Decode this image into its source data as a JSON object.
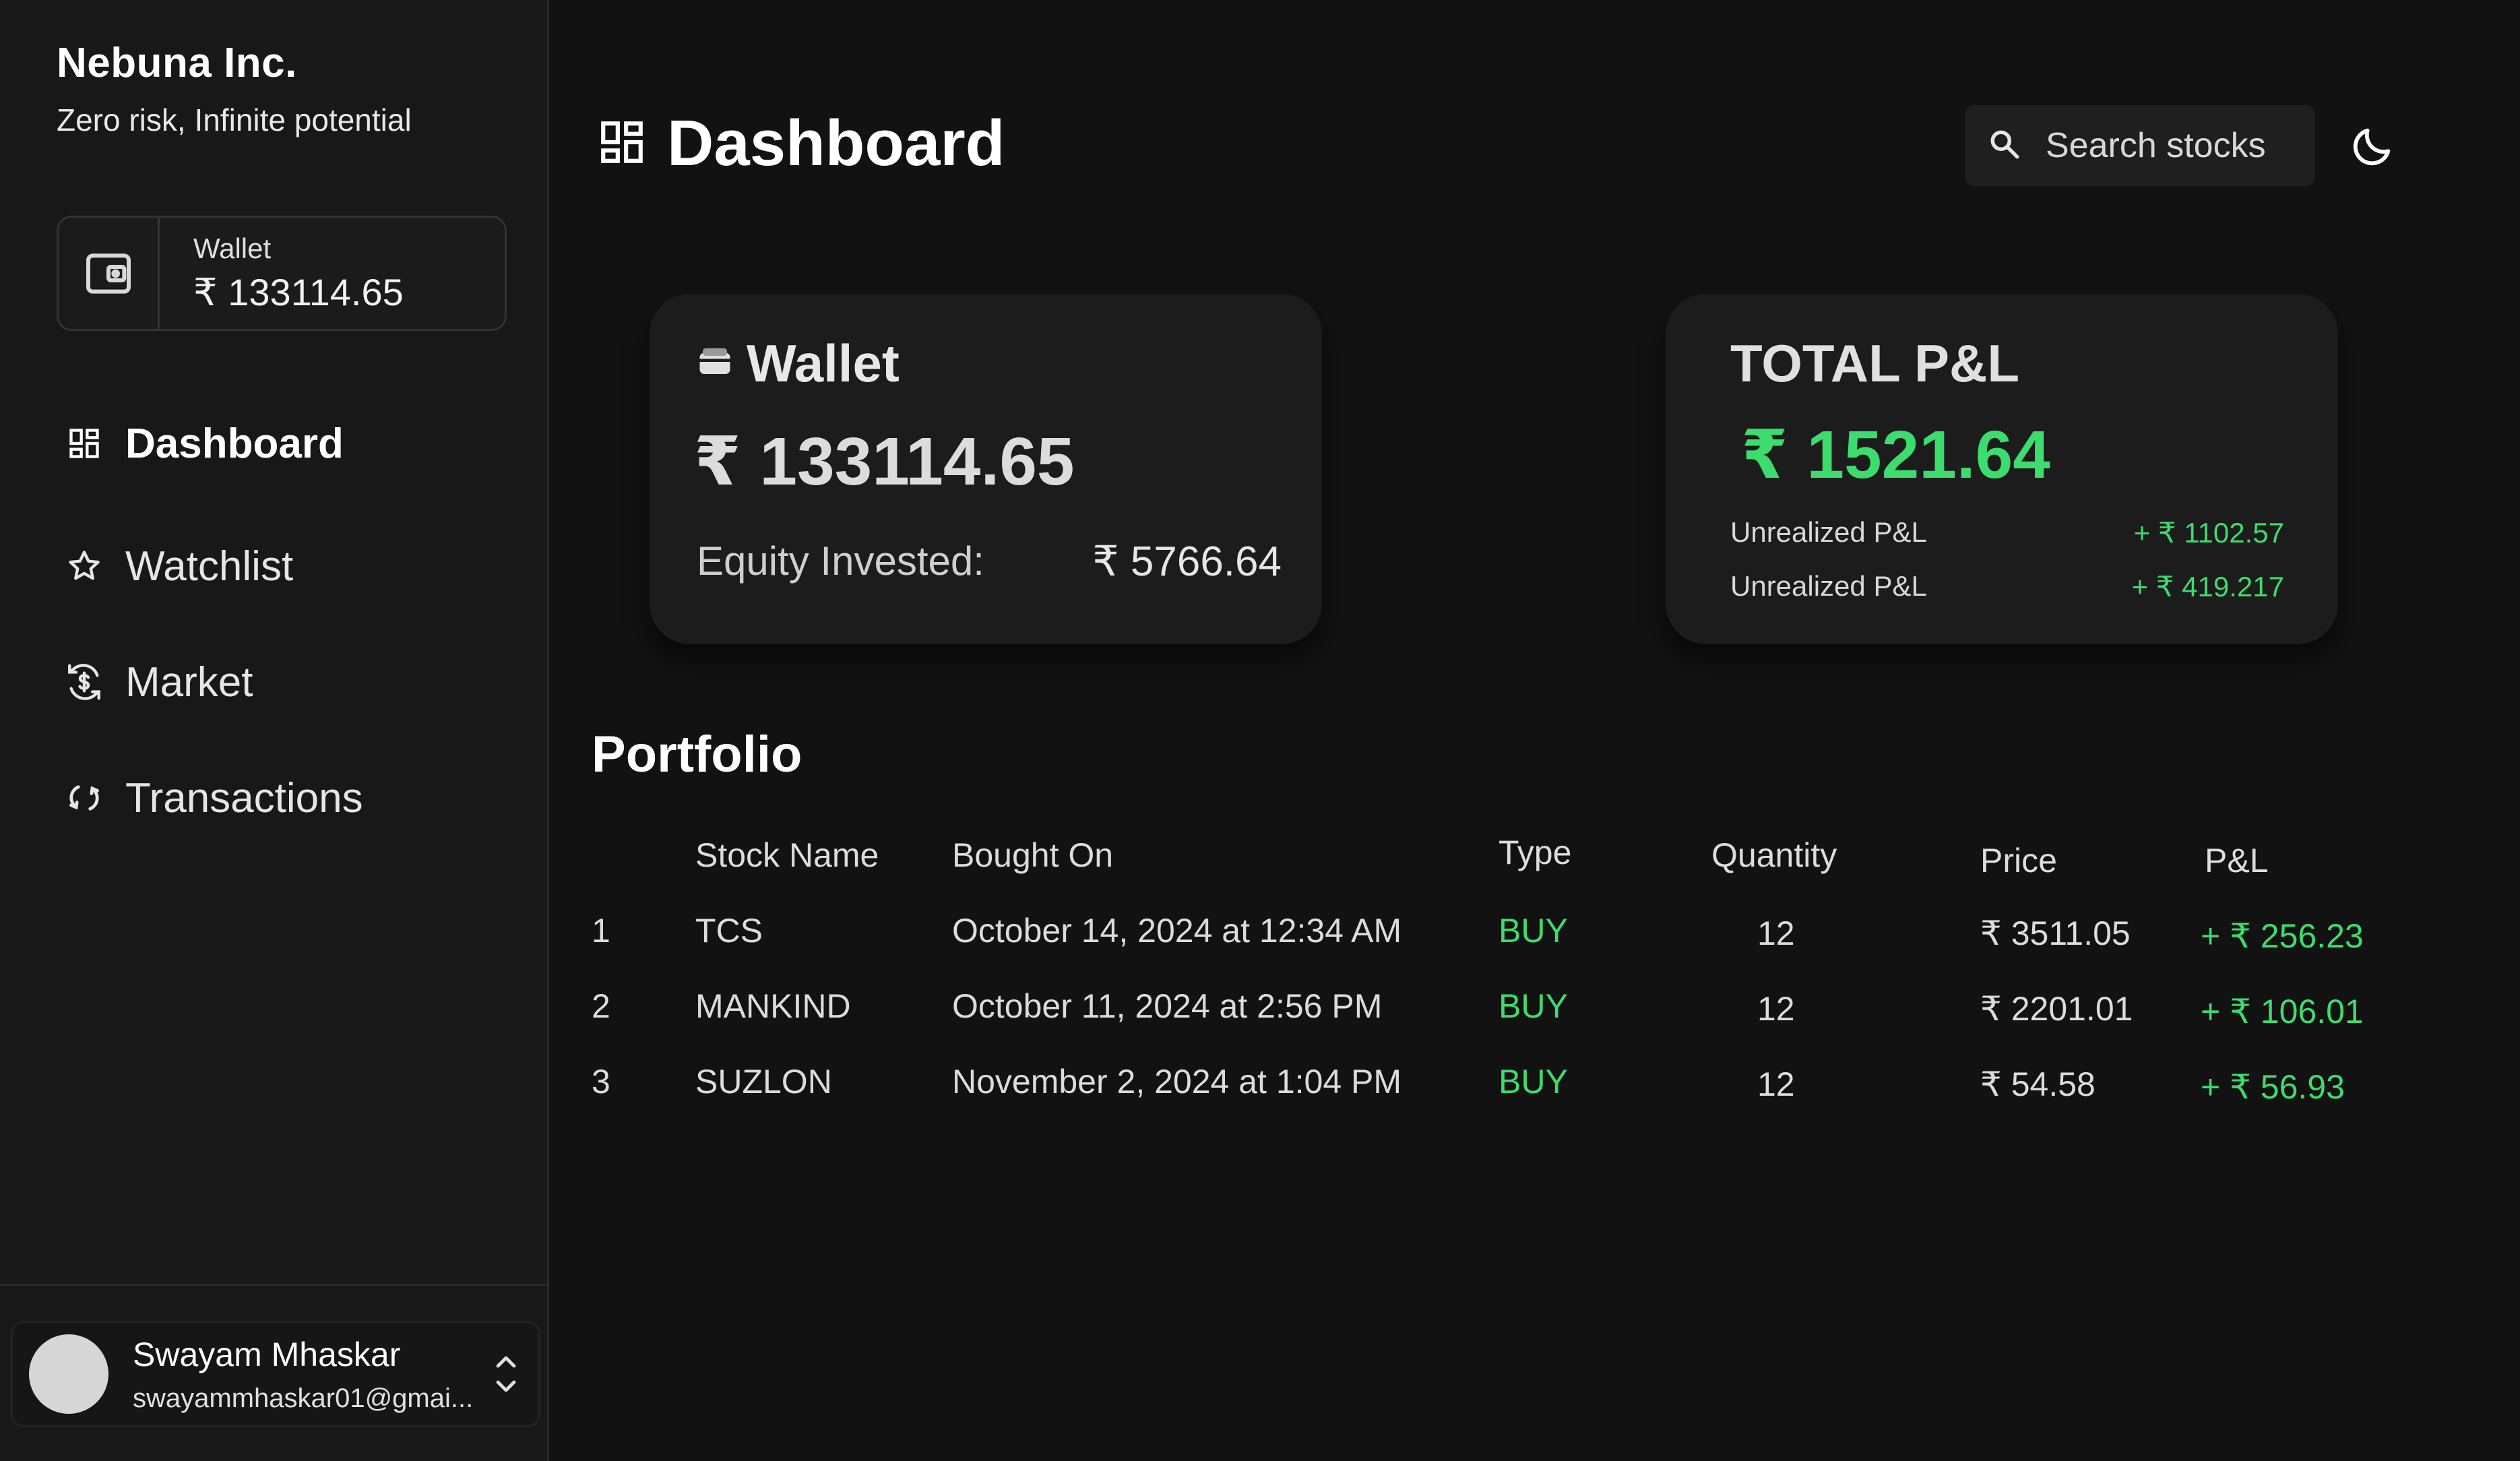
{
  "brand": {
    "name": "Nebuna Inc.",
    "tagline": "Zero risk, Infinite potential"
  },
  "sidebar": {
    "wallet": {
      "label": "Wallet",
      "value": "₹ 133114.65"
    },
    "nav": [
      {
        "label": "Dashboard",
        "icon": "dashboard-icon",
        "active": true
      },
      {
        "label": "Watchlist",
        "icon": "star-icon",
        "active": false
      },
      {
        "label": "Market",
        "icon": "currency-exchange-icon",
        "active": false
      },
      {
        "label": "Transactions",
        "icon": "sync-icon",
        "active": false
      }
    ],
    "user": {
      "name": "Swayam Mhaskar",
      "email": "swayammhaskar01@gmai..."
    }
  },
  "header": {
    "title": "Dashboard",
    "search_placeholder": "Search stocks"
  },
  "wallet_card": {
    "title": "Wallet",
    "balance": "₹ 133114.65",
    "equity_label": "Equity Invested:",
    "equity_value": "₹ 5766.64"
  },
  "pl_card": {
    "title": "TOTAL P&L",
    "total": "₹ 1521.64",
    "rows": [
      {
        "label": "Unrealized P&L",
        "value": "+ ₹ 1102.57"
      },
      {
        "label": "Unrealized P&L",
        "value": "+ ₹ 419.217"
      }
    ]
  },
  "portfolio": {
    "title": "Portfolio",
    "columns": [
      "Stock Name",
      "Bought On",
      "Type",
      "Quantity",
      "Price",
      "P&L"
    ],
    "rows": [
      {
        "index": "1",
        "stock": "TCS",
        "bought_on": "October 14, 2024 at 12:34 AM",
        "type": "BUY",
        "quantity": "12",
        "price": "₹ 3511.05",
        "pl": "+ ₹ 256.23"
      },
      {
        "index": "2",
        "stock": "MANKIND",
        "bought_on": "October 11, 2024 at 2:56 PM",
        "type": "BUY",
        "quantity": "12",
        "price": "₹ 2201.01",
        "pl": "+ ₹ 106.01"
      },
      {
        "index": "3",
        "stock": "SUZLON",
        "bought_on": "November 2, 2024 at 1:04 PM",
        "type": "BUY",
        "quantity": "12",
        "price": "₹ 54.58",
        "pl": "+ ₹ 56.93"
      }
    ]
  },
  "colors": {
    "background": "#121212",
    "sidebar": "#181818",
    "card": "#1c1c1c",
    "positive": "#3ddc6e"
  }
}
